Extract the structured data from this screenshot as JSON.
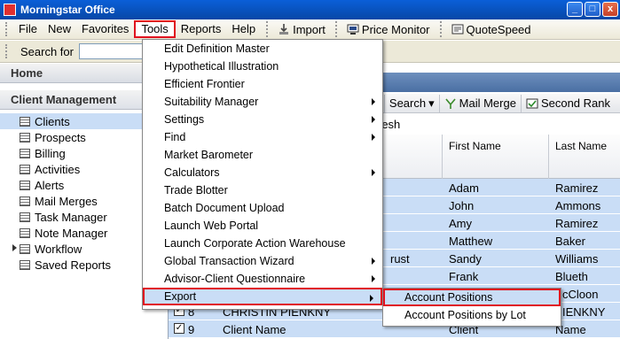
{
  "window": {
    "title": "Morningstar Office",
    "controls": [
      "_",
      "□",
      "x"
    ]
  },
  "menubar": {
    "items": [
      "File",
      "New",
      "Favorites",
      "Tools",
      "Reports",
      "Help"
    ],
    "import_label": "Import",
    "price_monitor_label": "Price Monitor",
    "quotespeed_label": "QuoteSpeed"
  },
  "search": {
    "label": "Search for"
  },
  "sidebar": {
    "home": "Home",
    "section": "Client Management",
    "items": [
      "Clients",
      "Prospects",
      "Billing",
      "Activities",
      "Alerts",
      "Mail Merges",
      "Task Manager",
      "Note Manager",
      "Workflow",
      "Saved Reports"
    ]
  },
  "toolbar2": {
    "search_label": "Search",
    "mail_merge_label": "Mail Merge",
    "second_rank_label": "Second Rank"
  },
  "refresh_fragment": "resh",
  "grid": {
    "headers": {
      "first_name": "First Name",
      "last_name": "Last Name"
    },
    "rows": [
      {
        "first": "Adam",
        "last": "Ramirez",
        "mid": ""
      },
      {
        "first": "John",
        "last": "Ammons",
        "mid": ""
      },
      {
        "first": "Amy",
        "last": "Ramirez",
        "mid": ""
      },
      {
        "first": "Matthew",
        "last": "Baker",
        "mid": ""
      },
      {
        "first": "Sandy",
        "last": "Williams",
        "mid": "rust"
      },
      {
        "first": "Frank",
        "last": "Blueth",
        "mid": ""
      },
      {
        "first": "",
        "last": "cCloon",
        "mid": ""
      },
      {
        "num": "8",
        "name": "CHRISTIN PIENKNY",
        "last": "IENKNY"
      },
      {
        "num": "9",
        "name": "Client Name",
        "first": "Client",
        "last": "Name"
      }
    ]
  },
  "tools_menu": {
    "items": [
      {
        "label": "Edit Definition Master",
        "submenu": false
      },
      {
        "label": "Hypothetical Illustration",
        "submenu": false
      },
      {
        "label": "Efficient Frontier",
        "submenu": false
      },
      {
        "label": "Suitability Manager",
        "submenu": true
      },
      {
        "label": "Settings",
        "submenu": true
      },
      {
        "label": "Find",
        "submenu": true
      },
      {
        "label": "Market Barometer",
        "submenu": false
      },
      {
        "label": "Calculators",
        "submenu": true
      },
      {
        "label": "Trade Blotter",
        "submenu": false
      },
      {
        "label": "Batch Document Upload",
        "submenu": false
      },
      {
        "label": "Launch Web Portal",
        "submenu": false
      },
      {
        "label": "Launch Corporate Action Warehouse",
        "submenu": false
      },
      {
        "label": "Global Transaction Wizard",
        "submenu": true
      },
      {
        "label": "Advisor-Client Questionnaire",
        "submenu": true
      },
      {
        "label": "Export",
        "submenu": true
      }
    ]
  },
  "export_submenu": {
    "items": [
      "Account Positions",
      "Account Positions by Lot"
    ]
  }
}
